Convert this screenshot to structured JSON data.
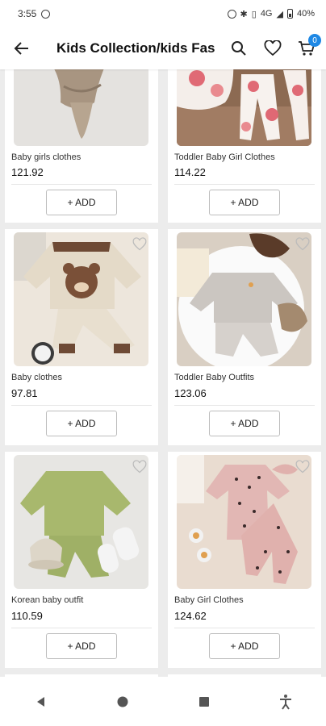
{
  "status_bar": {
    "time": "3:55",
    "network": "4G",
    "battery": "40%"
  },
  "app_bar": {
    "title": "Kids Collection/kids Fashion",
    "cart_count": "0"
  },
  "products": [
    {
      "name": "Baby girls clothes",
      "price": "121.92",
      "add_label": "+ ADD",
      "image": "beige-romper-set"
    },
    {
      "name": "Toddler Baby Girl Clothes",
      "price": "114.22",
      "add_label": "+ ADD",
      "image": "floral-set"
    },
    {
      "name": "Baby clothes",
      "price": "97.81",
      "add_label": "+ ADD",
      "image": "bear-sweater-set"
    },
    {
      "name": "Toddler Baby Outfits",
      "price": "123.06",
      "add_label": "+ ADD",
      "image": "grey-sweatsuit"
    },
    {
      "name": "Korean baby outfit",
      "price": "110.59",
      "add_label": "+ ADD",
      "image": "green-knit-set"
    },
    {
      "name": "Baby Girl Clothes",
      "price": "124.62",
      "add_label": "+ ADD",
      "image": "pink-heart-set"
    }
  ],
  "colors": {
    "accent": "#1e88e5",
    "background": "#ececec"
  }
}
